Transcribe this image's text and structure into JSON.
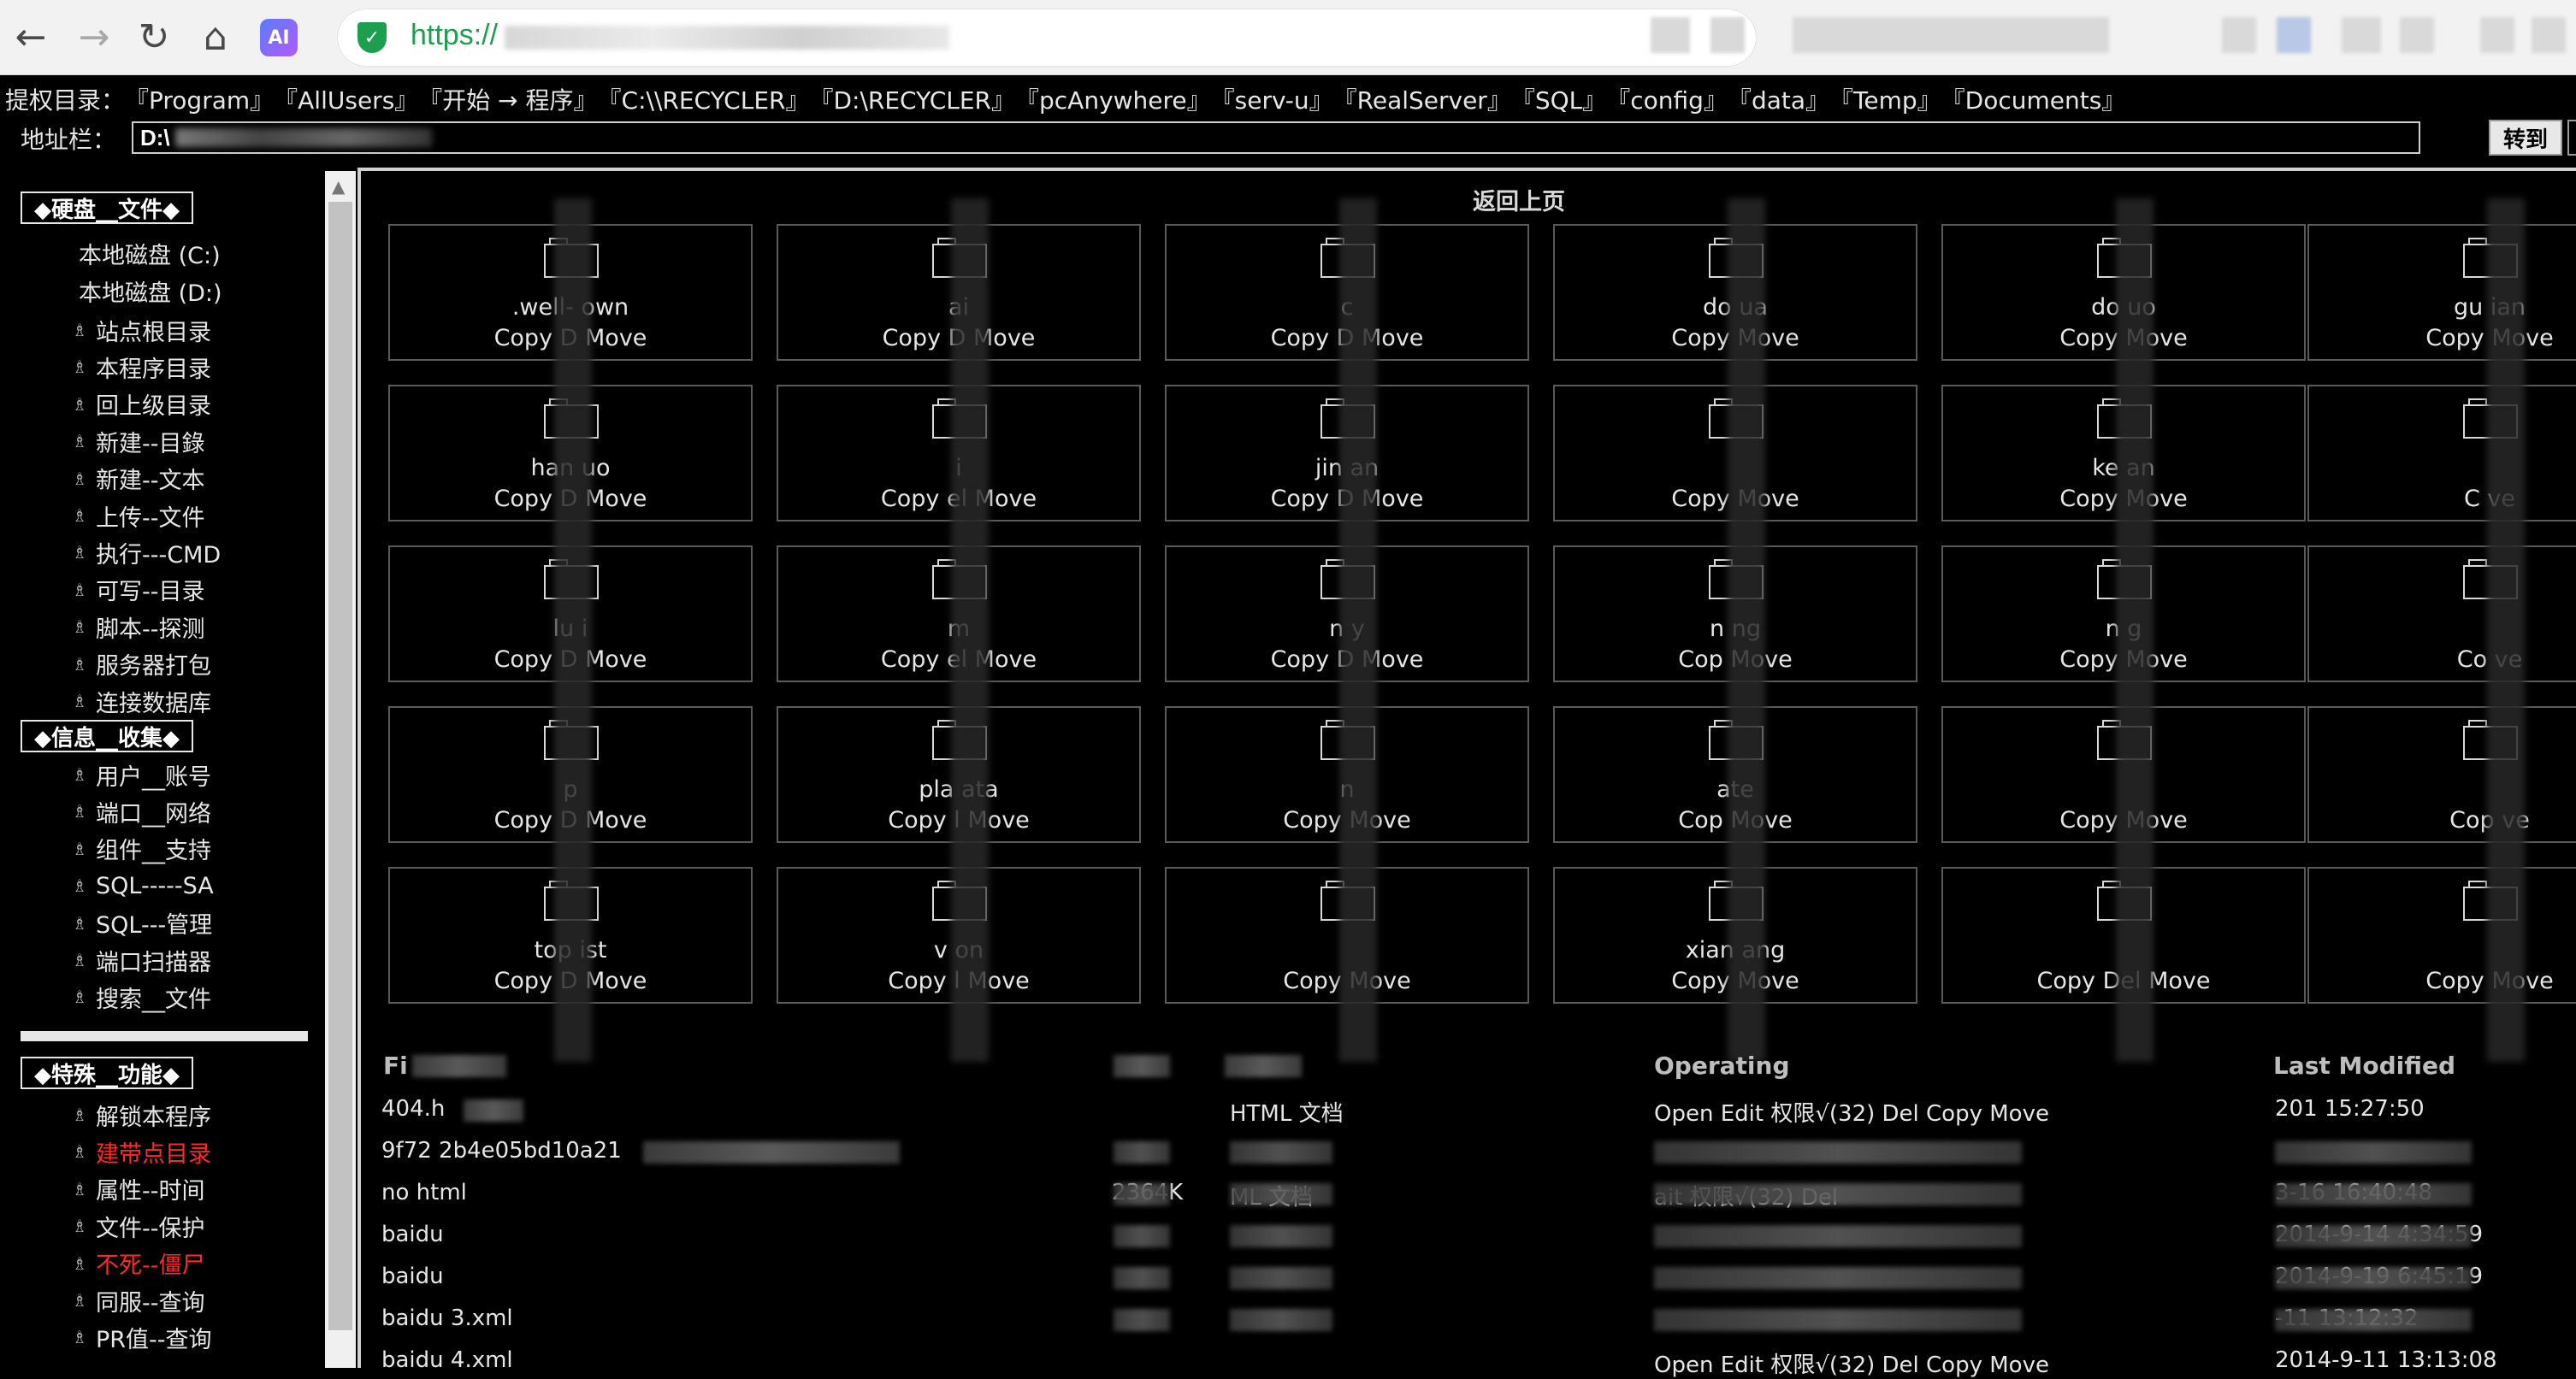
{
  "browser": {
    "url_scheme": "https://",
    "ai_label": "AI"
  },
  "toolbar": {
    "priv_label": "提权目录：",
    "priv_links": [
      "『Program』",
      "『AllUsers』",
      "『开始 → 程序』",
      "『C:\\\\RECYCLER』",
      "『D:\\RECYCLER』",
      "『pcAnywhere』",
      "『serv-u』",
      "『RealServer』",
      "『SQL』",
      "『config』",
      "『data』",
      "『Temp』",
      "『Documents』"
    ],
    "address_label": "地址栏：",
    "address_value": "D:\\",
    "goto_label": "转到"
  },
  "sidebar": {
    "disk_title": "◆硬盘__文件◆",
    "drives": [
      "本地磁盘 (C:)",
      "本地磁盘 (D:)"
    ],
    "disk_items": [
      "站点根目录",
      "本程序目录",
      "回上级目录",
      "新建--目錄",
      "新建--文本",
      "上传--文件",
      "执行---CMD",
      "可写--目录",
      "脚本--探测",
      "服务器打包",
      "连接数据库"
    ],
    "info_title": "◆信息__收集◆",
    "info_items": [
      "用户__账号",
      "端口__网络",
      "组件__支持",
      "SQL-----SA",
      "SQL---管理",
      "端口扫描器",
      "搜索__文件"
    ],
    "special_title": "◆特殊__功能◆",
    "special_items": [
      {
        "label": "解锁本程序",
        "red": false
      },
      {
        "label": "建带点目录",
        "red": true
      },
      {
        "label": "属性--时间",
        "red": false
      },
      {
        "label": "文件--保护",
        "red": false
      },
      {
        "label": "不死--僵尸",
        "red": true
      },
      {
        "label": "同服--查询",
        "red": false
      },
      {
        "label": "PR值--查询",
        "red": false
      }
    ],
    "bullet": "♗"
  },
  "main": {
    "back_label": "返回上页",
    "tiles": [
      {
        "name": ".well-   own",
        "actions": "Copy D    Move"
      },
      {
        "name": "ai   ",
        "actions": "Copy D   Move"
      },
      {
        "name": "c  ",
        "actions": "Copy D    Move"
      },
      {
        "name": "do   ua",
        "actions": "Copy      Move"
      },
      {
        "name": "do   uo",
        "actions": "Copy      Move"
      },
      {
        "name": "gu   ian",
        "actions": "Copy     Move"
      },
      {
        "name": "han   uo",
        "actions": "Copy D    Move"
      },
      {
        "name": "i  ",
        "actions": "Copy  el Move"
      },
      {
        "name": "jin   an",
        "actions": "Copy D    Move"
      },
      {
        "name": "",
        "actions": "Copy      Move"
      },
      {
        "name": "ke   an",
        "actions": "Copy      Move"
      },
      {
        "name": "",
        "actions": "C     ve"
      },
      {
        "name": "lu  i",
        "actions": "Copy D    Move"
      },
      {
        "name": "m",
        "actions": "Copy  el Move"
      },
      {
        "name": "n    y",
        "actions": "Copy D    Move"
      },
      {
        "name": "n    ng",
        "actions": "Cop      Move"
      },
      {
        "name": "n   g",
        "actions": "Copy      Move"
      },
      {
        "name": "",
        "actions": "Co      ve"
      },
      {
        "name": "p  ",
        "actions": "Copy D    Move"
      },
      {
        "name": "pla   ata",
        "actions": "Copy   l Move"
      },
      {
        "name": "n   ",
        "actions": "Copy      Move"
      },
      {
        "name": "   ate",
        "actions": "Cop      Move"
      },
      {
        "name": "",
        "actions": "Copy      Move"
      },
      {
        "name": "",
        "actions": "Cop      ve"
      },
      {
        "name": "top   ist",
        "actions": "Copy D    Move"
      },
      {
        "name": "v   on",
        "actions": "Copy  l Move"
      },
      {
        "name": "",
        "actions": "Copy      Move"
      },
      {
        "name": "xian   ang",
        "actions": "Copy      Move"
      },
      {
        "name": "",
        "actions": "Copy Del Move"
      },
      {
        "name": "",
        "actions": "Copy     Move"
      }
    ]
  },
  "file_table": {
    "headers": {
      "name": "Fi",
      "operating": "Operating",
      "modified": "Last Modified"
    },
    "rows": [
      {
        "name": "404.h",
        "size": "",
        "type": "HTML 文档",
        "ops": "Open Edit 权限√(32) Del Copy Move",
        "modified": "201      15:27:50"
      },
      {
        "name": "9f72   2b4e05bd10a21",
        "size": "",
        "type": "",
        "ops": "",
        "modified": ""
      },
      {
        "name": "    no     html",
        "size": "2364K",
        "type": "   ML 文档",
        "ops": "    ait 权限√(32) Del   ",
        "modified": "    3-16 16:40:48"
      },
      {
        "name": "baidu",
        "size": "",
        "type": "",
        "ops": "",
        "modified": "2014-9-14 4:34:59"
      },
      {
        "name": "baidu",
        "size": "",
        "type": "",
        "ops": "",
        "modified": "2014-9-19 6:45:19"
      },
      {
        "name": "baidu 3.xml",
        "size": "",
        "type": "",
        "ops": "",
        "modified": "    -11 13:12:32"
      },
      {
        "name": "baidu 4.xml",
        "size": "",
        "type": "",
        "ops": "Open Edit 权限√(32) Del Copy Move",
        "modified": "2014-9-11 13:13:08"
      }
    ]
  }
}
